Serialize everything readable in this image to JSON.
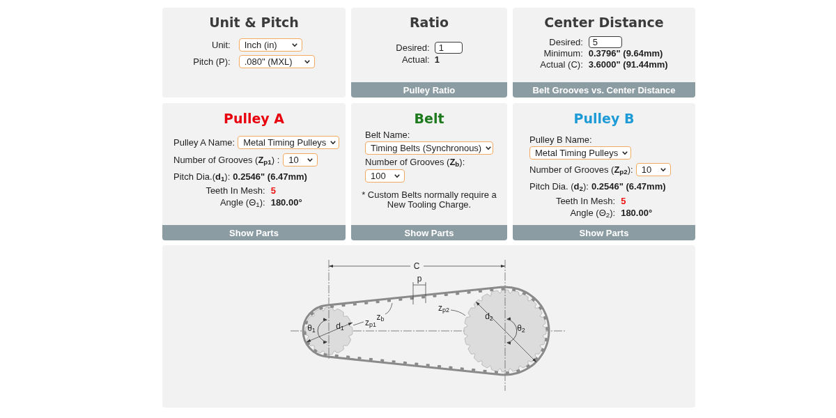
{
  "unit_pitch": {
    "title": "Unit & Pitch",
    "fields": [
      {
        "label": "Unit:",
        "value": "Inch (in)"
      },
      {
        "label": "Pitch (P):",
        "value": ".080\" (MXL)"
      }
    ]
  },
  "ratio": {
    "title": "Ratio",
    "desired": {
      "label": "Desired:",
      "value": "1"
    },
    "actual": {
      "label": "Actual:",
      "value": "1"
    },
    "footer": "Pulley Ratio"
  },
  "center_distance": {
    "title": "Center Distance",
    "desired": {
      "label": "Desired:",
      "value": "5"
    },
    "results": [
      {
        "label": "Minimum:",
        "value": "0.3796\" (9.64mm)"
      },
      {
        "label": "Actual (C):",
        "value": "3.6000\" (91.44mm)"
      }
    ],
    "footer": "Belt Grooves vs. Center Distance"
  },
  "pulley_a": {
    "title": "Pulley A",
    "name": {
      "label": "Pulley A Name:",
      "value": "Metal Timing Pulleys"
    },
    "grooves": {
      "label": "Number of Grooves (**Z**$_{p1}$) :",
      "value": "10"
    },
    "pitch_dia": {
      "label": "Pitch Dia.(**d**$_{1}$):",
      "value": "0.2546\" (6.47mm)"
    },
    "teeth_in_mesh": {
      "label": "Teeth In Mesh:",
      "value": "5"
    },
    "angle": {
      "label": "Angle (Θ$_{1}$):",
      "value": "180.00°"
    },
    "footer": "Show Parts"
  },
  "belt": {
    "title": "Belt",
    "name": {
      "label": "Belt Name:",
      "value": "Timing Belts (Synchronous)"
    },
    "grooves": {
      "label": "Number of Grooves (**Z**$_{b}$):",
      "value": "100"
    },
    "note": "* Custom Belts normally require a New Tooling Charge.",
    "footer": "Show Parts"
  },
  "pulley_b": {
    "title": "Pulley B",
    "name": {
      "label": "Pulley B Name:",
      "value": "Metal Timing Pulleys"
    },
    "grooves": {
      "label": "Number of Grooves (**Z**$_{p2}$):",
      "value": "10"
    },
    "pitch_dia": {
      "label": "Pitch Dia. (**d**$_{2}$):",
      "value": "0.2546\" (6.47mm)"
    },
    "teeth_in_mesh": {
      "label": "Teeth In Mesh:",
      "value": "5"
    },
    "angle": {
      "label": "Angle (Θ$_{2}$):",
      "value": "180.00°"
    },
    "footer": "Show Parts"
  },
  "diagram": {
    "labels": [
      "C",
      "p",
      "z$_{b}$",
      "θ$_{1}$",
      "d$_{1}$",
      "z$_{p1}$",
      "z$_{p2}$",
      "d$_{2}$",
      "θ$_{2}$"
    ]
  }
}
